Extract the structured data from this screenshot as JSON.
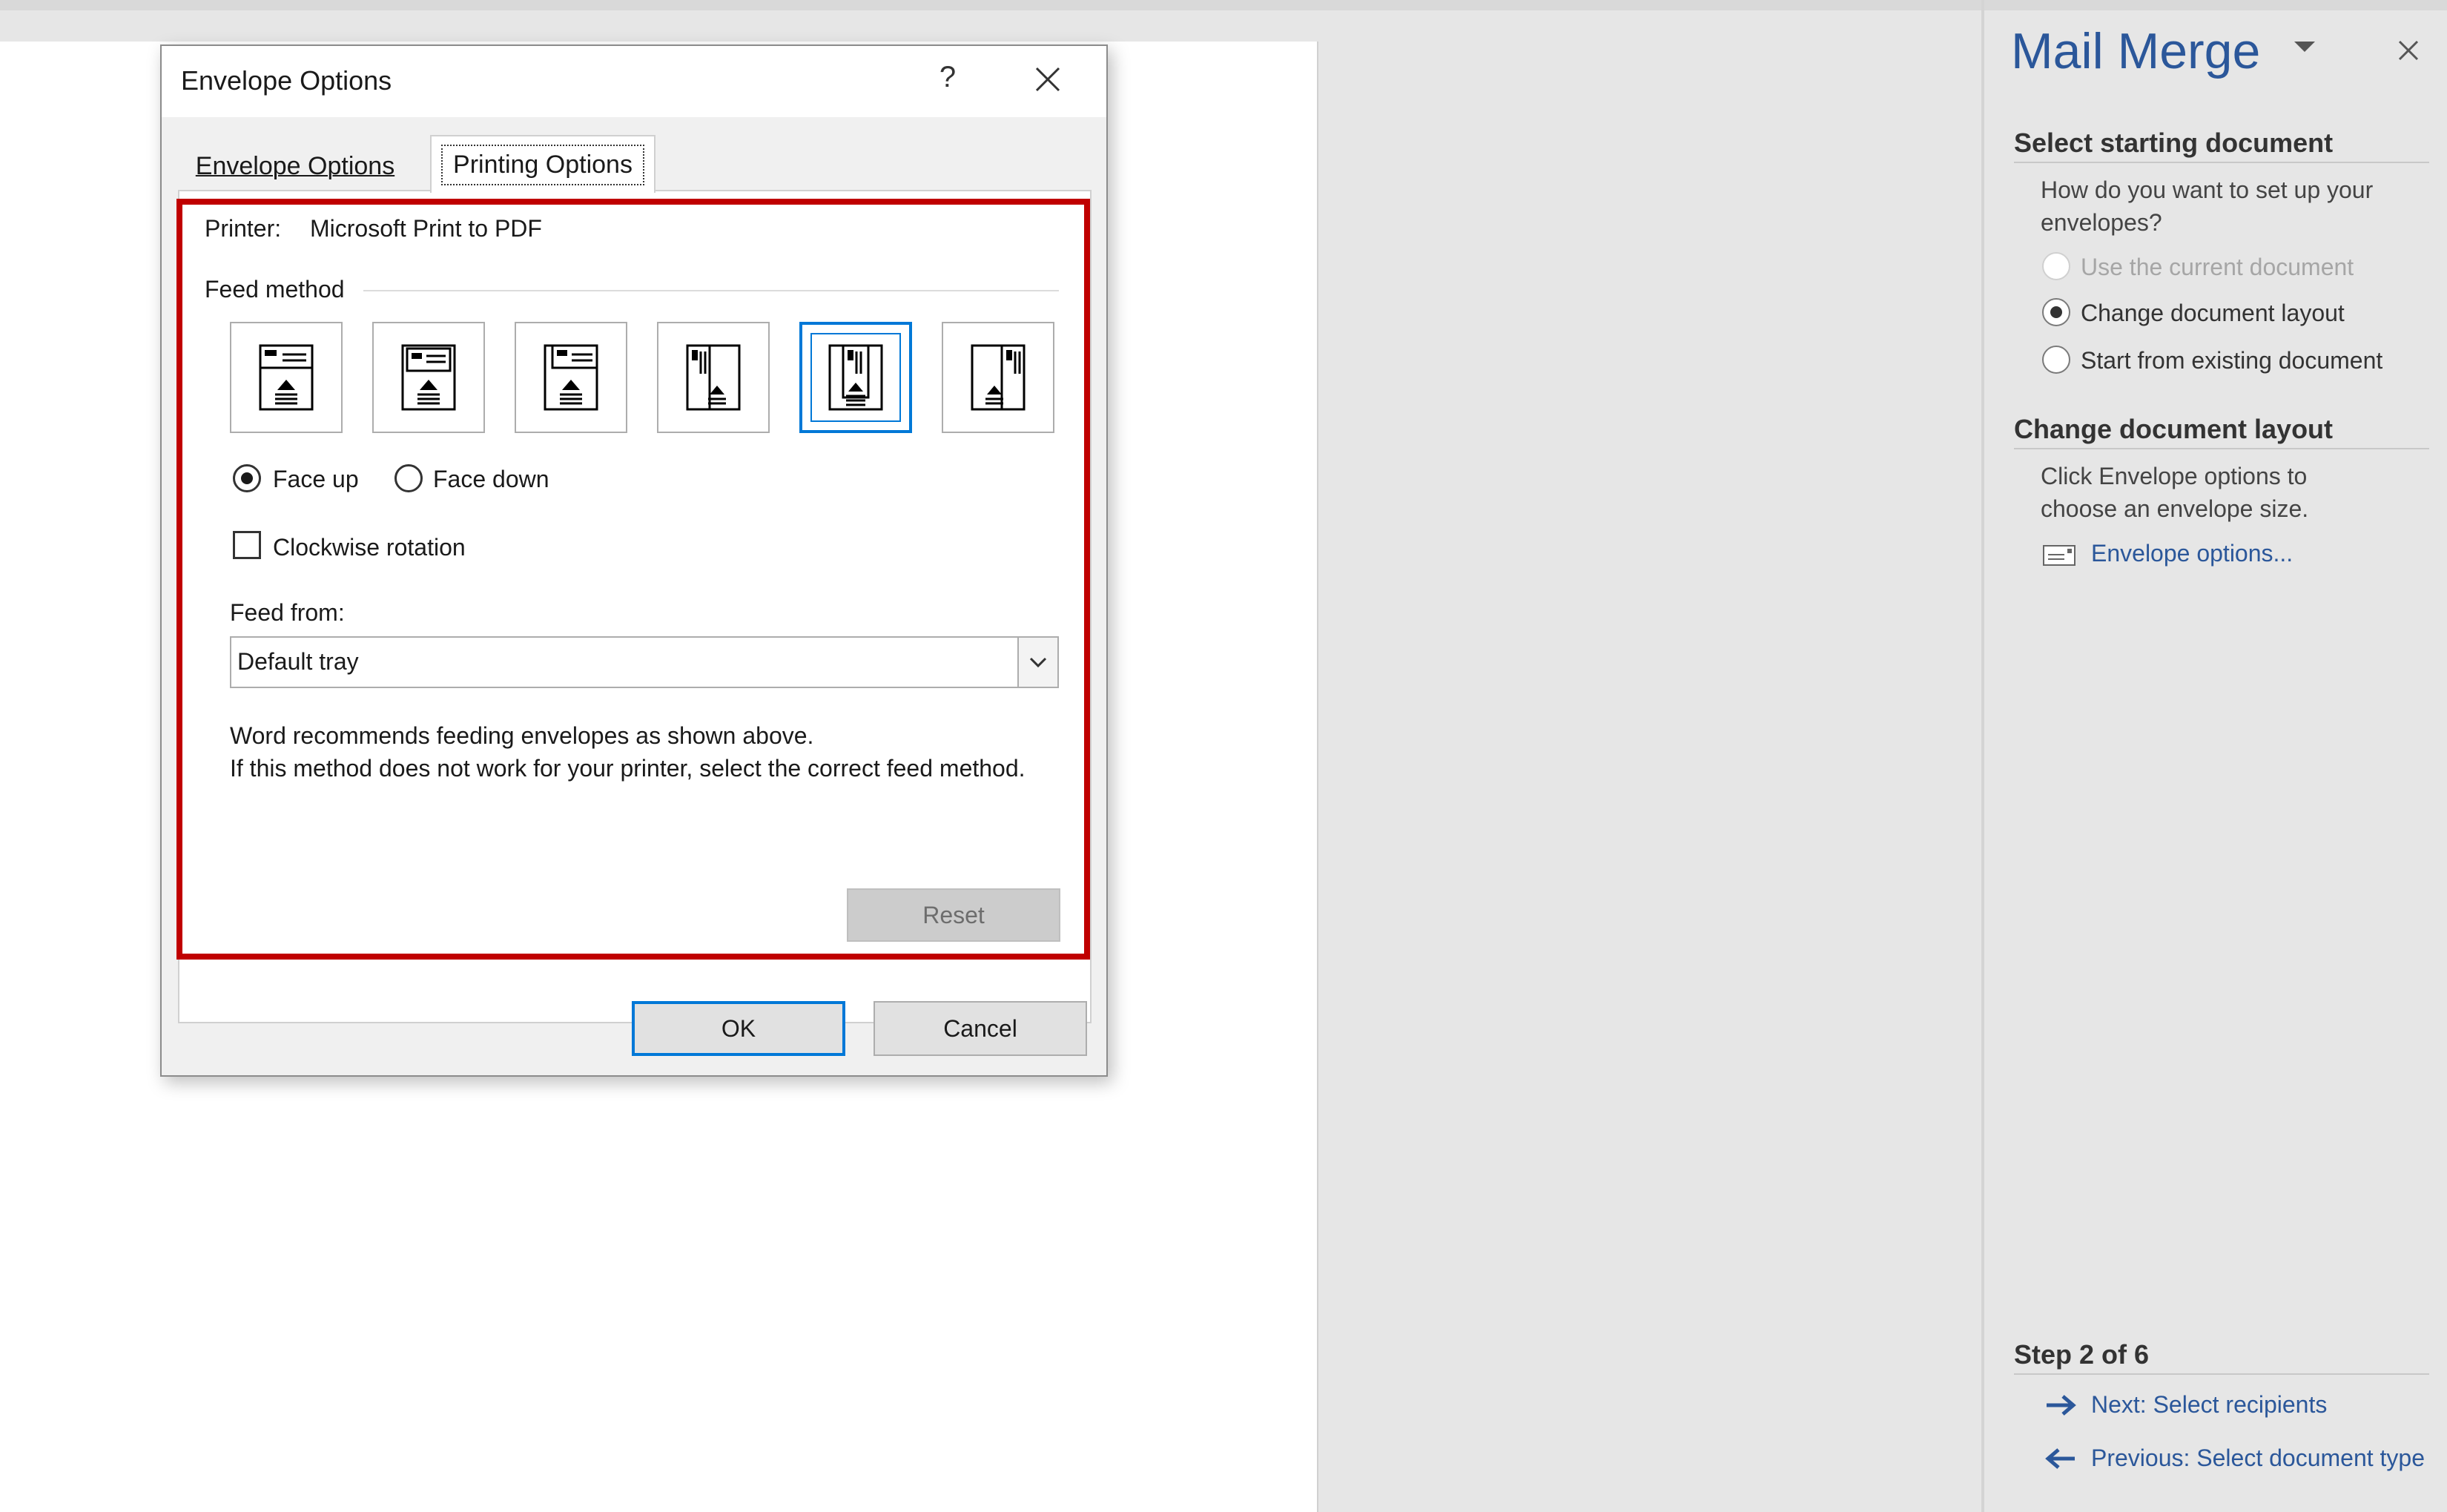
{
  "dialog": {
    "title": "Envelope Options",
    "help_glyph": "?",
    "tabs": [
      {
        "label": "Envelope Options",
        "selected": false
      },
      {
        "label": "Printing Options",
        "selected": true
      }
    ],
    "printer_label": "Printer:",
    "printer_value": "Microsoft Print to PDF",
    "feed_method_label": "Feed method",
    "feed_methods_selected_index": 4,
    "face_up_label": "Face up",
    "face_down_label": "Face down",
    "face_selected": "Face up",
    "clockwise_label": "Clockwise rotation",
    "clockwise_checked": false,
    "feed_from_label": "Feed from:",
    "feed_from_value": "Default tray",
    "message_line1": "Word recommends feeding envelopes as shown above.",
    "message_line2": "If this method does not work for your printer, select the correct feed method.",
    "reset_label": "Reset",
    "ok_label": "OK",
    "cancel_label": "Cancel"
  },
  "mail_merge": {
    "title": "Mail Merge",
    "section1_heading": "Select starting document",
    "section1_question": "How do you want to set up your envelopes?",
    "options": [
      {
        "label": "Use the current document",
        "state": "disabled"
      },
      {
        "label": "Change document layout",
        "state": "checked"
      },
      {
        "label": "Start from existing document",
        "state": "unchecked"
      }
    ],
    "section2_heading": "Change document layout",
    "section2_text": "Click Envelope options to choose an envelope size.",
    "envelope_options_link": "Envelope options...",
    "step_label": "Step 2 of 6",
    "next_link": "Next: Select recipients",
    "previous_link": "Previous: Select document type"
  },
  "colors": {
    "accent": "#0078d7",
    "pane_title": "#2b579a",
    "highlight": "#c00000"
  }
}
